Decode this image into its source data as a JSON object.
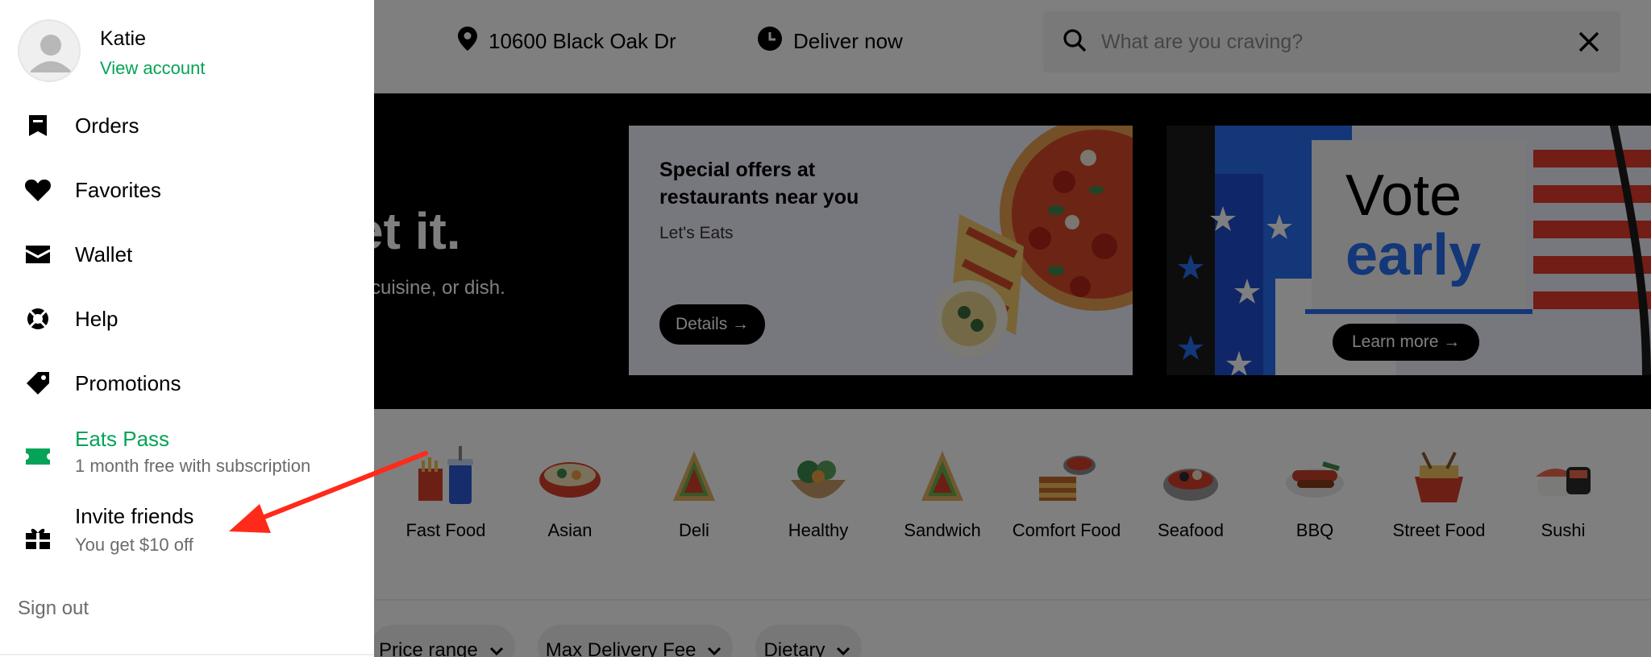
{
  "header": {
    "address": "10600 Black Oak Dr",
    "delivery_time": "Deliver now",
    "search_placeholder": "What are you craving?"
  },
  "hero": {
    "title_visible": "et it.",
    "subtitle_visible": "t, cuisine, or dish."
  },
  "promo_cards": [
    {
      "title": "Special offers at restaurants near you",
      "subtitle": "Let's Eats",
      "button": "Details →"
    },
    {
      "headline_line1": "Vote",
      "headline_line2": "early",
      "button": "Learn more →"
    }
  ],
  "categories": [
    {
      "label": "Fast Food",
      "icon": "fast-food-icon"
    },
    {
      "label": "Asian",
      "icon": "asian-icon"
    },
    {
      "label": "Deli",
      "icon": "deli-icon"
    },
    {
      "label": "Healthy",
      "icon": "healthy-icon"
    },
    {
      "label": "Sandwich",
      "icon": "sandwich-icon"
    },
    {
      "label": "Comfort Food",
      "icon": "comfort-food-icon"
    },
    {
      "label": "Seafood",
      "icon": "seafood-icon"
    },
    {
      "label": "BBQ",
      "icon": "bbq-icon"
    },
    {
      "label": "Street Food",
      "icon": "street-food-icon"
    },
    {
      "label": "Sushi",
      "icon": "sushi-icon"
    }
  ],
  "filters": [
    "Price range",
    "Max Delivery Fee",
    "Dietary"
  ],
  "drawer": {
    "user_name": "Katie",
    "view_account": "View account",
    "menu": [
      {
        "label": "Orders",
        "icon": "receipt-icon"
      },
      {
        "label": "Favorites",
        "icon": "heart-icon"
      },
      {
        "label": "Wallet",
        "icon": "wallet-icon"
      },
      {
        "label": "Help",
        "icon": "lifebuoy-icon"
      },
      {
        "label": "Promotions",
        "icon": "tag-icon"
      },
      {
        "label": "Eats Pass",
        "sub": "1 month free with subscription",
        "icon": "ticket-icon"
      },
      {
        "label": "Invite friends",
        "sub": "You get $10 off",
        "icon": "gift-icon"
      }
    ],
    "sign_out": "Sign out"
  },
  "colors": {
    "brand_green": "#05a357",
    "annotation_arrow": "#ff2a1a",
    "overlay": "rgba(0,0,0,0.5)",
    "promo_card_bg": "#eeeefd",
    "vote_card_bg": "#276ef1"
  }
}
